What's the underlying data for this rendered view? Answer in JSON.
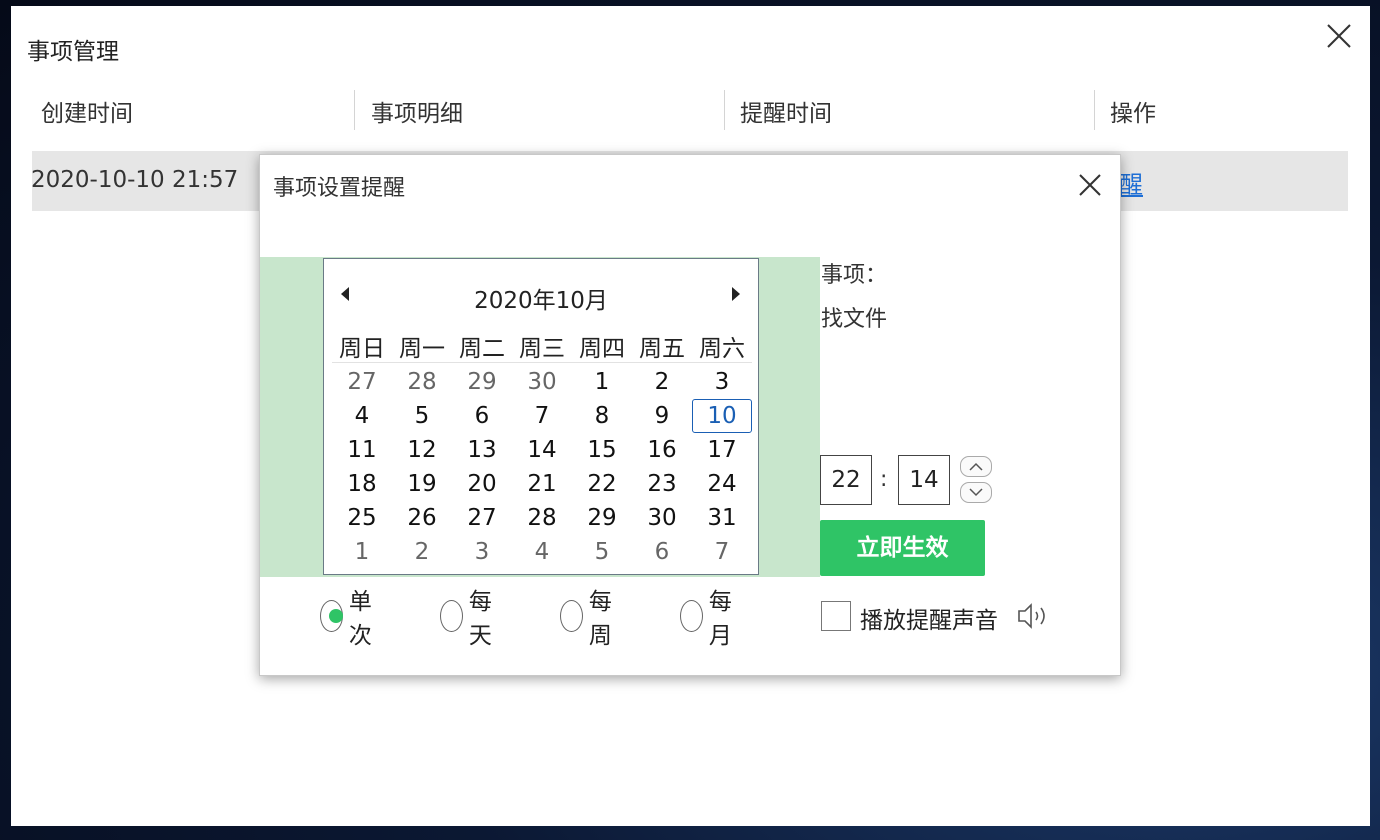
{
  "outer": {
    "title": "事项管理",
    "columns": [
      "创建时间",
      "事项明细",
      "提醒时间",
      "操作"
    ],
    "row": {
      "created": "2020-10-10 21:57",
      "action_partial": "醒"
    }
  },
  "modal": {
    "title": "事项设置提醒",
    "calendar": {
      "month_label": "2020年10月",
      "weekdays": [
        "周日",
        "周一",
        "周二",
        "周三",
        "周四",
        "周五",
        "周六"
      ],
      "weeks": [
        [
          "27",
          "28",
          "29",
          "30",
          "1",
          "2",
          "3"
        ],
        [
          "4",
          "5",
          "6",
          "7",
          "8",
          "9",
          "10"
        ],
        [
          "11",
          "12",
          "13",
          "14",
          "15",
          "16",
          "17"
        ],
        [
          "18",
          "19",
          "20",
          "21",
          "22",
          "23",
          "24"
        ],
        [
          "25",
          "26",
          "27",
          "28",
          "29",
          "30",
          "31"
        ],
        [
          "1",
          "2",
          "3",
          "4",
          "5",
          "6",
          "7"
        ]
      ],
      "selected_day": "10"
    },
    "item_label": "事项：",
    "item_value": "找文件",
    "time": {
      "hour": "22",
      "separator": ":",
      "minute": "14"
    },
    "apply_label": "立即生效",
    "repeat_options": [
      "单次",
      "每天",
      "每周",
      "每月"
    ],
    "repeat_selected": "单次",
    "sound_label": "播放提醒声音",
    "sound_checked": false,
    "colors": {
      "accent_green": "#2fc466",
      "calendar_band": "#c8e6cc",
      "selected_blue": "#1a5fb4",
      "link_blue": "#1e6fd6"
    },
    "icons": [
      "close-icon",
      "chevron-left-icon",
      "chevron-right-icon",
      "chevron-up-icon",
      "chevron-down-icon",
      "speaker-icon"
    ]
  }
}
